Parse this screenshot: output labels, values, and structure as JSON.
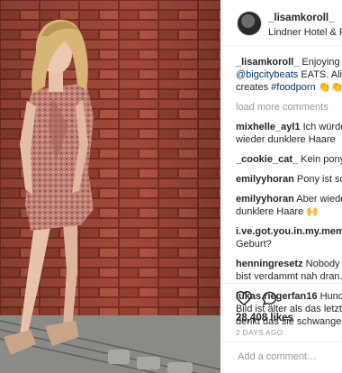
{
  "post": {
    "username": "_lisamkoroll_",
    "location": "Lindner Hotel & Re"
  },
  "caption": {
    "username": "_lisamkoroll_",
    "text_start": "Enjoying da",
    "mention": "@bigcitybeats",
    "text_mid": " EATS. Alisa",
    "text_end": "creates ",
    "hashtag": "#foodporn",
    "emoji": "👏👏"
  },
  "load_more": "load more comments",
  "comments": [
    {
      "user": "mixhelle_ayl1",
      "line1": "Ich würde k",
      "line2": "wieder dunklere Haare"
    },
    {
      "user": "_cookie_cat_",
      "line1": "Kein pony",
      "line2": ""
    },
    {
      "user": "emilyyhoran",
      "line1": "Pony ist so g",
      "line2": ""
    },
    {
      "user": "emilyyhoran",
      "line1": "Aber wieder",
      "line2": "dunklere Haare 🙌"
    },
    {
      "user": "i.ve.got.you.in.my.memes",
      "line1": "",
      "line2": "Geburt?"
    },
    {
      "user": "henningresetz",
      "line1": "Nobody is",
      "line2": "bist verdammt nah dran.🙌"
    },
    {
      "user": "lukas.riegerfan16",
      "line1": "Hunder",
      "line2": "Bild ist älter als das letzte",
      "line3": "denkt das sie schwanger i"
    }
  ],
  "icons": {
    "like": "heart-outline-icon",
    "comment": "comment-bubble-icon"
  },
  "likes": "28,408 likes",
  "time_ago": "2 DAYS AGO",
  "add_comment_placeholder": "Add a comment…",
  "colors": {
    "link": "#003569",
    "muted": "#999999",
    "text": "#262626"
  }
}
